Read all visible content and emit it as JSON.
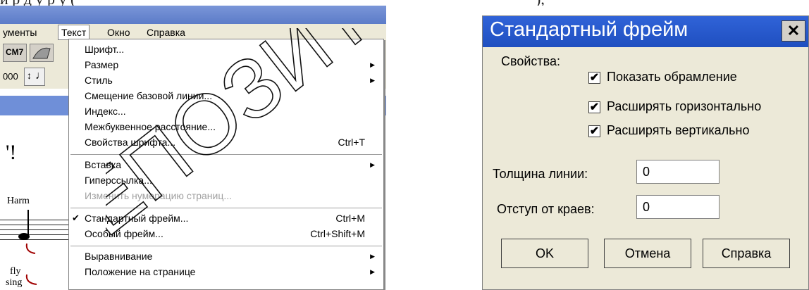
{
  "caption": {
    "left": "и р        д      у     р      у (",
    "right": "),"
  },
  "app": {
    "menubar": [
      "ументы",
      "Текст",
      "Окно",
      "Справка"
    ],
    "toolbar": {
      "chord_label": "CM7",
      "value_label": "000"
    },
    "score": {
      "exclaim": "'!",
      "harm": "Harm",
      "fly": "fly",
      "sing": "sing"
    }
  },
  "menu": {
    "items": [
      {
        "label": "Шрифт...",
        "shortcut": "",
        "submenu": false
      },
      {
        "label": "Размер",
        "shortcut": "",
        "submenu": true
      },
      {
        "label": "Стиль",
        "shortcut": "",
        "submenu": true
      },
      {
        "label": "Смещение базовой линии...",
        "shortcut": "",
        "submenu": false
      },
      {
        "label": "Индекс...",
        "shortcut": "",
        "submenu": false
      },
      {
        "label": "Межбуквенное расстояние...",
        "shortcut": "",
        "submenu": false
      },
      {
        "label": "Свойства шрифта...",
        "shortcut": "Ctrl+T",
        "submenu": false
      },
      {
        "label": "Вставка",
        "shortcut": "",
        "submenu": true
      },
      {
        "label": "Гиперссылка...",
        "shortcut": "",
        "submenu": false
      },
      {
        "label": "Изменить нумерацию страниц...",
        "shortcut": "",
        "submenu": false,
        "disabled": true
      },
      {
        "label": "Стандартный фрейм...",
        "shortcut": "Ctrl+M",
        "submenu": false,
        "checked": true
      },
      {
        "label": "Особый фрейм...",
        "shortcut": "Ctrl+Shift+M",
        "submenu": false
      },
      {
        "label": "Выравнивание",
        "shortcut": "",
        "submenu": true
      },
      {
        "label": "Положение на странице",
        "shortcut": "",
        "submenu": true
      }
    ]
  },
  "dialog": {
    "title": "Стандартный фрейм",
    "close": "✕",
    "properties_label": "Свойства:",
    "checkboxes": [
      {
        "label": "Показать обрамление",
        "checked": true
      },
      {
        "label": "Расширять горизонтально",
        "checked": true
      },
      {
        "label": "Расширять вертикально",
        "checked": true
      }
    ],
    "line_thickness_label": "Толщина линии:",
    "line_thickness_value": "0",
    "margin_label": "Отступ от краев:",
    "margin_value": "0",
    "buttons": {
      "ok": "OK",
      "cancel": "Отмена",
      "help": "Справка"
    }
  },
  "watermark": {
    "text": "ЕПОЗИТОРИЙ"
  },
  "colors": {
    "title_blue": "#1f4fc0",
    "menu_bg": "#ece9d8",
    "watermark": "#000000"
  }
}
